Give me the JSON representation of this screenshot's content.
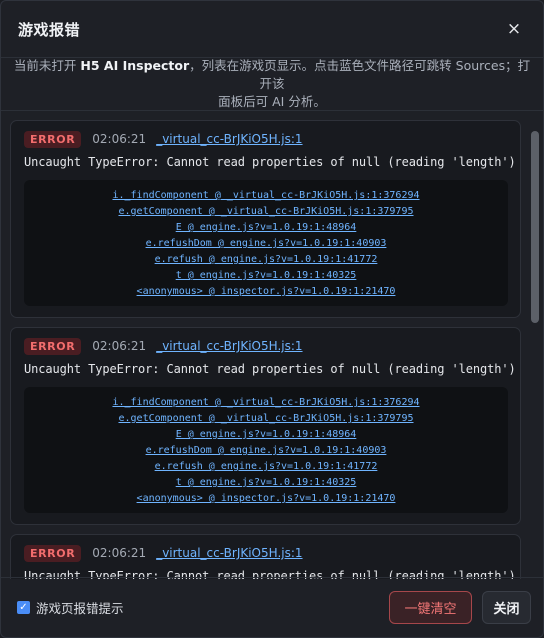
{
  "dialog": {
    "title": "游戏报错",
    "close_glyph": "×"
  },
  "notice": {
    "line1_prefix": "当前未打开 ",
    "line1_bold": "H5 AI Inspector",
    "line1_suffix": "，列表在游戏页显示。点击蓝色文件路径可跳转 Sources；打开该",
    "line2": "面板后可 AI 分析。"
  },
  "errors": [
    {
      "badge": "ERROR",
      "time": "02:06:21",
      "source": "_virtual_cc-BrJKiO5H.js:1",
      "message": "Uncaught TypeError: Cannot read properties of null (reading 'length')",
      "stack": [
        "i._findComponent @ _virtual_cc-BrJKiO5H.js:1:376294",
        "e.getComponent @ _virtual_cc-BrJKiO5H.js:1:379795",
        "E @ engine.js?v=1.0.19:1:48964",
        "e.refushDom @ engine.js?v=1.0.19:1:40903",
        "e.refush @ engine.js?v=1.0.19:1:41772",
        "t @ engine.js?v=1.0.19:1:40325",
        "<anonymous> @ inspector.js?v=1.0.19:1:21470"
      ]
    },
    {
      "badge": "ERROR",
      "time": "02:06:21",
      "source": "_virtual_cc-BrJKiO5H.js:1",
      "message": "Uncaught TypeError: Cannot read properties of null (reading 'length')",
      "stack": [
        "i._findComponent @ _virtual_cc-BrJKiO5H.js:1:376294",
        "e.getComponent @ _virtual_cc-BrJKiO5H.js:1:379795",
        "E @ engine.js?v=1.0.19:1:48964",
        "e.refushDom @ engine.js?v=1.0.19:1:40903",
        "e.refush @ engine.js?v=1.0.19:1:41772",
        "t @ engine.js?v=1.0.19:1:40325",
        "<anonymous> @ inspector.js?v=1.0.19:1:21470"
      ]
    },
    {
      "badge": "ERROR",
      "time": "02:06:21",
      "source": "_virtual_cc-BrJKiO5H.js:1",
      "message": "Uncaught TypeError: Cannot read properties of null (reading 'length')"
    }
  ],
  "footer": {
    "checkbox_label": "游戏页报错提示",
    "checkbox_checked": true,
    "check_glyph": "✓",
    "clear_label": "一键清空",
    "close_label": "关闭"
  },
  "colors": {
    "accent_blue": "#6fb4ff",
    "error_red": "#f26d6d",
    "checkbox_blue": "#4a8df6"
  }
}
